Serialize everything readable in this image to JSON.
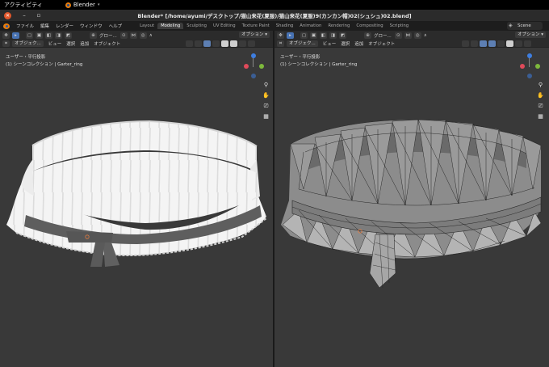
{
  "gnome": {
    "activities": "アクティビティ",
    "app_name": "Blender",
    "app_caret": "▾"
  },
  "window": {
    "title": "Blender* [/home/ayumi/デスクトップ/猫山来花(夏服)/猫山来花(夏服)9(カンカン帽)02(シュシュ)02.blend]",
    "close_glyph": "✕",
    "min_glyph": "–",
    "max_glyph": "▫"
  },
  "header": {
    "menus": [
      "ファイル",
      "編集",
      "レンダー",
      "ウィンドウ",
      "ヘルプ"
    ],
    "workspace_tabs": [
      "Layout",
      "Modeling",
      "Sculpting",
      "UV Editing",
      "Texture Paint",
      "Shading",
      "Animation",
      "Rendering",
      "Compositing",
      "Scripting"
    ],
    "active_tab": "Modeling",
    "scene": "Scene"
  },
  "viewport_left": {
    "orientation": "グロー...",
    "options": "オプション ▾",
    "mode": "オブジェク...",
    "menus": [
      "ビュー",
      "選択",
      "追加",
      "オブジェクト"
    ],
    "view_name": "ユーザー・平行投影",
    "collection": "(1) シーンコレクション | Garter_ring",
    "shading": "solid"
  },
  "viewport_right": {
    "orientation": "グロー...",
    "options": "オプション ▾",
    "mode": "オブジェク...",
    "menus": [
      "ビュー",
      "選択",
      "追加",
      "オブジェクト"
    ],
    "view_name": "ユーザー・平行投影",
    "collection": "(1) シーンコレクション | Garter_ring",
    "shading": "wireframe-overlay"
  },
  "gizmo": {
    "axes": [
      "x",
      "y",
      "z"
    ],
    "colors": {
      "x": "#e04a5a",
      "y": "#7db83c",
      "z": "#3e7ee0"
    }
  },
  "icons": {
    "zoom": "magnifier-icon",
    "pan": "hand-icon",
    "camera": "camera-icon",
    "ortho": "grid-icon"
  },
  "colors": {
    "viewport_bg": "#393939",
    "header_bg": "#2b2b2b",
    "accent": "#4772b3",
    "mesh_white": "#f2f2f2",
    "band_dark": "#5a5a5a"
  }
}
